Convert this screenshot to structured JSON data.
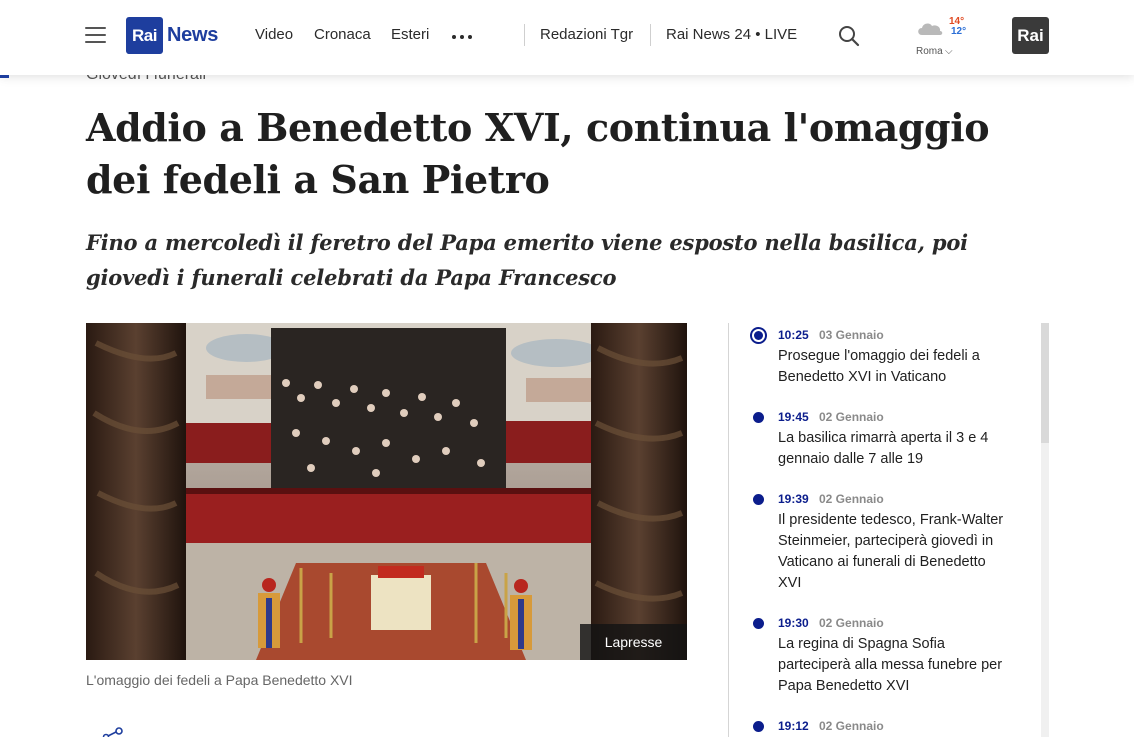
{
  "header": {
    "logo": {
      "rai": "Rai",
      "news": "News"
    },
    "nav": [
      "Video",
      "Cronaca",
      "Esteri"
    ],
    "secondary_nav": [
      "Redazioni Tgr",
      "Rai News 24 • LIVE"
    ],
    "weather": {
      "max": "14°",
      "min": "12°",
      "city": "Roma",
      "icon": "cloud-icon"
    },
    "corner_logo": "Rai",
    "colors": {
      "brand": "#1e3e9e",
      "accent": "#0b1d8c"
    }
  },
  "article": {
    "kicker": "Giovedì i funerali",
    "title": "Addio a Benedetto XVI, continua l'omaggio dei fedeli a San Pietro",
    "subtitle": "Fino a mercoledì il feretro del Papa emerito viene esposto nella basilica, poi giovedì i funerali celebrati da Papa Francesco",
    "photo_credit": "Lapresse",
    "caption": "L'omaggio dei fedeli a Papa Benedetto XVI"
  },
  "timeline": [
    {
      "time": "10:25",
      "date": "03 Gennaio",
      "text": "Prosegue l'omaggio dei fedeli a Benedetto XVI in Vaticano"
    },
    {
      "time": "19:45",
      "date": "02 Gennaio",
      "text": "La basilica rimarrà aperta il 3 e 4 gennaio dalle 7 alle 19"
    },
    {
      "time": "19:39",
      "date": "02 Gennaio",
      "text": "Il presidente tedesco, Frank-Walter Steinmeier, parteciperà giovedì in Vaticano ai funerali di Benedetto XVI"
    },
    {
      "time": "19:30",
      "date": "02 Gennaio",
      "text": "La regina di Spagna Sofia parteciperà alla messa funebre per Papa Benedetto XVI"
    },
    {
      "time": "19:12",
      "date": "02 Gennaio",
      "text": ""
    }
  ]
}
